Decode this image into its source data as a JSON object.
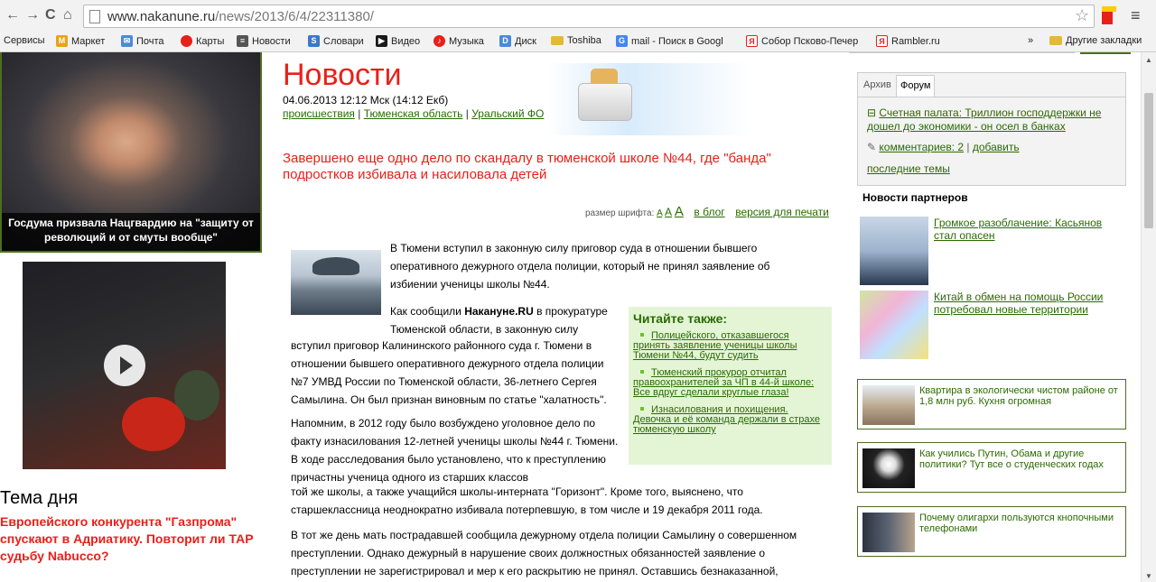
{
  "browser": {
    "url_host": "www.nakanune.ru",
    "url_path": "/news/2013/6/4/22311380/",
    "back": "←",
    "forward": "→",
    "reload": "C",
    "home": "⌂",
    "star": "☆",
    "menu": "≡"
  },
  "bookmarks": {
    "items": [
      "Сервисы",
      "Маркет",
      "Почта",
      "Карты",
      "Новости",
      "Словари",
      "Видео",
      "Музыка",
      "Диск",
      "Toshiba",
      "mail - Поиск в Googl",
      "Собор Псково-Печер",
      "Rambler.ru"
    ],
    "more": "»",
    "other": "Другие закладки"
  },
  "left": {
    "feature_caption": "Госдума призвала Нацгвардию на \"защиту от революций и от смуты вообще\"",
    "topic_title": "Тема дня",
    "topic_text": "Европейского конкурента \"Газпрома\" спускают в Адриатику. Повторит ли ТАР судьбу Nabucco?"
  },
  "article": {
    "section_title": "Новости",
    "date": "04.06.2013 12:12 Мск (14:12 Екб)",
    "categories": [
      "происшествия",
      "Тюменская область",
      "Уральский ФО"
    ],
    "separator": "|",
    "lead": "Завершено еще одно дело по скандалу в тюменской школе №44, где \"банда\" подростков избивала и насиловала детей",
    "font_size_label": "размер шрифта:",
    "font_a": "A",
    "to_blog": "в блог",
    "print_version": "версия для печати",
    "p1": "В Тюмени вступил в законную силу приговор суда в отношении бывшего оперативного дежурного отдела полиции, который не принял заявление об избиении ученицы школы №44.",
    "p2_prefix": "Как сообщили ",
    "p2_source": "Накануне.RU",
    "p2_a": " в прокуратуре Тюменской области, в законную силу",
    "p2_b": "вступил приговор Калининского районного суда г. Тюмени в отношении бывшего оперативного дежурного отдела полиции №7 УМВД России по Тюменской области, 36-летнего Сергея Самылина. Он был признан виновным по статье \"халатность\".",
    "p3": "Напомним, в 2012 году было возбуждено уголовное дело по факту изнасилования 12-летней ученицы школы №44 г. Тюмени. В ходе расследования было установлено, что к преступлению причастны ученица одного из старших классов",
    "p3b": "той же школы, а также учащийся школы-интерната \"Горизонт\". Кроме того, выяснено, что старшеклассница неоднократно избивала потерпевшую, в том числе и 19 декабря 2011 года.",
    "p4": "В тот же день мать пострадавшей сообщила дежурному отдела полиции Самылину о совершенном преступлении. Однако дежурный в нарушение своих должностных обязанностей заявление о преступлении не зарегистрировал и мер к его раскрытию не принял. Оставшись безнаказанной,"
  },
  "see_also": {
    "title": "Читайте также:",
    "items": [
      "Полицейского, отказавшегося принять заявление ученицы школы Тюмени №44, будут судить",
      "Тюменский прокурор отчитал правоохранителей за ЧП в 44-й школе: Все вдруг сделали круглые глаза!",
      "Изнасилования и похищения. Девочка и её команда держали в страхе тюменскую школу"
    ]
  },
  "right": {
    "tabs": [
      "Архив",
      "Форум"
    ],
    "active_tab": "Форум",
    "forum_topic": "Счетная палата: Триллион господдержки не дошел до экономики - он осел в банках",
    "comments_label": "комментариев: 2",
    "add_label": "добавить",
    "last_topics": "последние темы",
    "partners_title": "Новости партнеров",
    "partner_news": [
      "Громкое разоблачение: Касьянов стал опасен",
      "Китай в обмен на помощь России потребовал новые территории"
    ],
    "ads": [
      "Квартира в экологически чистом районе от 1,8 млн руб. Кухня огромная",
      "Как учились Путин, Обама и другие политики? Тут все о студенческих годах",
      "Почему олигархи пользуются кнопочными телефонами"
    ]
  },
  "colors": {
    "accent_red": "#e8201a",
    "link_green": "#2a6b00",
    "box_green": "#e4f5d6"
  }
}
